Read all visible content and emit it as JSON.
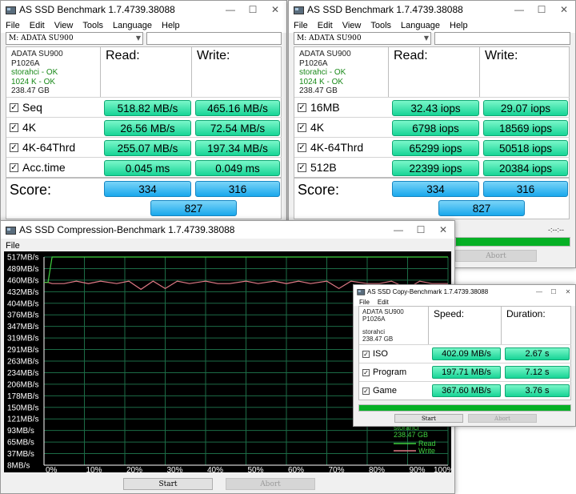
{
  "win1": {
    "title": "AS SSD Benchmark 1.7.4739.38088",
    "menu": [
      "File",
      "Edit",
      "View",
      "Tools",
      "Language",
      "Help"
    ],
    "drive": "M: ADATA SU900",
    "info": [
      "ADATA SU900",
      "P1026A",
      "storahci - OK",
      "1024 K - OK",
      "238.47 GB"
    ],
    "read_header": "Read:",
    "write_header": "Write:",
    "rows": [
      {
        "label": "Seq",
        "read": "518.82 MB/s",
        "write": "465.16 MB/s"
      },
      {
        "label": "4K",
        "read": "26.56 MB/s",
        "write": "72.54 MB/s"
      },
      {
        "label": "4K-64Thrd",
        "read": "255.07 MB/s",
        "write": "197.34 MB/s"
      },
      {
        "label": "Acc.time",
        "read": "0.045 ms",
        "write": "0.049 ms"
      }
    ],
    "score_label": "Score:",
    "score_read": "334",
    "score_write": "316",
    "score_total": "827"
  },
  "win2": {
    "title": "AS SSD Benchmark 1.7.4739.38088",
    "menu": [
      "File",
      "Edit",
      "View",
      "Tools",
      "Language",
      "Help"
    ],
    "drive": "M: ADATA SU900",
    "info": [
      "ADATA SU900",
      "P1026A",
      "storahci - OK",
      "1024 K - OK",
      "238.47 GB"
    ],
    "read_header": "Read:",
    "write_header": "Write:",
    "rows": [
      {
        "label": "16MB",
        "read": "32.43 iops",
        "write": "29.07 iops"
      },
      {
        "label": "4K",
        "read": "6798 iops",
        "write": "18569 iops"
      },
      {
        "label": "4K-64Thrd",
        "read": "65299 iops",
        "write": "50518 iops"
      },
      {
        "label": "512B",
        "read": "22399 iops",
        "write": "20384 iops"
      }
    ],
    "score_label": "Score:",
    "score_read": "334",
    "score_write": "316",
    "score_total": "827",
    "timer": "-:--:--",
    "abort": "Abort"
  },
  "compression": {
    "title": "AS SSD Compression-Benchmark 1.7.4739.38088",
    "menu": [
      "File"
    ],
    "drive_info": [
      "storahci",
      "238.47 GB"
    ],
    "legend_read": "Read",
    "legend_write": "Write",
    "start": "Start",
    "abort": "Abort",
    "colors": {
      "read": "#3fd13f",
      "write": "#e07a86",
      "grid": "#1c6b46"
    }
  },
  "copy": {
    "title": "AS SSD Copy-Benchmark 1.7.4739.38088",
    "menu": [
      "File",
      "Edit"
    ],
    "info": [
      "ADATA SU900",
      "P1026A",
      "",
      "storahci",
      "238.47 GB"
    ],
    "speed_header": "Speed:",
    "duration_header": "Duration:",
    "rows": [
      {
        "label": "ISO",
        "speed": "402.09 MB/s",
        "duration": "2.67 s"
      },
      {
        "label": "Program",
        "speed": "197.71 MB/s",
        "duration": "7.12 s"
      },
      {
        "label": "Game",
        "speed": "367.60 MB/s",
        "duration": "3.76 s"
      }
    ],
    "start": "Start",
    "abort": "Abort"
  },
  "chart_data": {
    "type": "line",
    "title": "",
    "xlabel": "",
    "ylabel": "",
    "y_tick_labels": [
      "517MB/s",
      "489MB/s",
      "460MB/s",
      "432MB/s",
      "404MB/s",
      "376MB/s",
      "347MB/s",
      "319MB/s",
      "291MB/s",
      "263MB/s",
      "234MB/s",
      "206MB/s",
      "178MB/s",
      "150MB/s",
      "121MB/s",
      "93MB/s",
      "65MB/s",
      "37MB/s",
      "8MB/s"
    ],
    "x_tick_labels": [
      "0%",
      "10%",
      "20%",
      "30%",
      "40%",
      "50%",
      "60%",
      "70%",
      "80%",
      "90%",
      "100%"
    ],
    "ylim": [
      8,
      517
    ],
    "xlim": [
      0,
      100
    ],
    "grid": true,
    "legend": "bottom-right",
    "series": [
      {
        "name": "Read",
        "x": [
          0,
          1,
          2,
          100
        ],
        "y": [
          455,
          455,
          517,
          517
        ]
      },
      {
        "name": "Write",
        "x": [
          0,
          1,
          2,
          5,
          8,
          11,
          14,
          18,
          21,
          24,
          27,
          30,
          33,
          36,
          40,
          43,
          46,
          50,
          53,
          57,
          60,
          63,
          66,
          70,
          73,
          76,
          80,
          83,
          86,
          90,
          93,
          96,
          100
        ],
        "y": [
          455,
          455,
          452,
          452,
          458,
          452,
          458,
          452,
          458,
          438,
          458,
          440,
          458,
          452,
          458,
          452,
          452,
          458,
          452,
          458,
          452,
          458,
          452,
          458,
          440,
          458,
          452,
          452,
          458,
          440,
          458,
          452,
          452
        ]
      }
    ]
  }
}
